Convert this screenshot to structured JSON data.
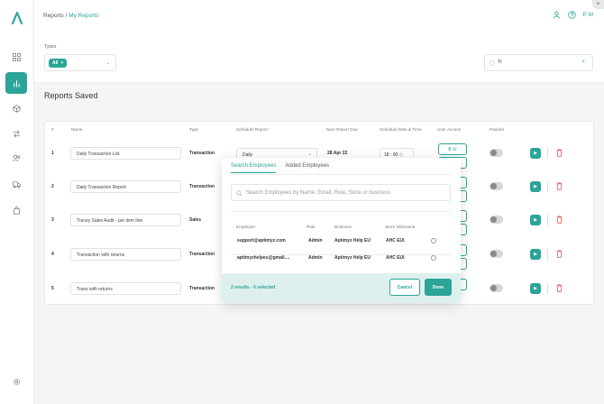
{
  "breadcrumb": {
    "root": "Reports",
    "separator": "/",
    "current": "My Reports"
  },
  "header": {
    "user_initials": "P M"
  },
  "filters": {
    "types_label": "Types",
    "types_chip": "All",
    "search_value": "Tr"
  },
  "page": {
    "section_title": "Reports Saved"
  },
  "table": {
    "headers": [
      "#",
      "Name",
      "Type",
      "Schedule Report",
      "Next Report Due",
      "Schedule Date & Time",
      "User Access",
      "Paused"
    ],
    "rows": [
      {
        "num": "1",
        "name": "Daily Transaction List",
        "type": "Transaction",
        "schedule": "Daily",
        "due": "28 Apr 22",
        "time": "18 : 00",
        "access": "0"
      },
      {
        "num": "2",
        "name": "Daily Transaction Report",
        "type": "Transaction"
      },
      {
        "num": "3",
        "name": "Tracey Sales Audit - per item line",
        "type": "Sales"
      },
      {
        "num": "4",
        "name": "Transaction with returns",
        "type": "Transaction"
      },
      {
        "num": "5",
        "name": "Trans with returns",
        "type": "Transaction"
      }
    ]
  },
  "modal": {
    "tabs": [
      "Search Employees",
      "Added Employees"
    ],
    "search_placeholder": "Search Employees by Name, Email, Role, Store or business",
    "headers": [
      "Employee",
      "Role",
      "Business",
      "Store Nickname"
    ],
    "rows": [
      {
        "employee": "support@aptimyz.com",
        "role": "Admin",
        "business": "Aptimyz Help EU",
        "store": "AHC EUI"
      },
      {
        "employee": "aptimyzhelpeu@gmail....",
        "role": "Admin",
        "business": "Aptimyz Help EU",
        "store": "AHC EUI"
      }
    ],
    "results_text": "2 results - 0 selected",
    "cancel_label": "Cancel",
    "done_label": "Done"
  },
  "colors": {
    "accent": "#2aa597",
    "danger": "#e05a5a"
  }
}
